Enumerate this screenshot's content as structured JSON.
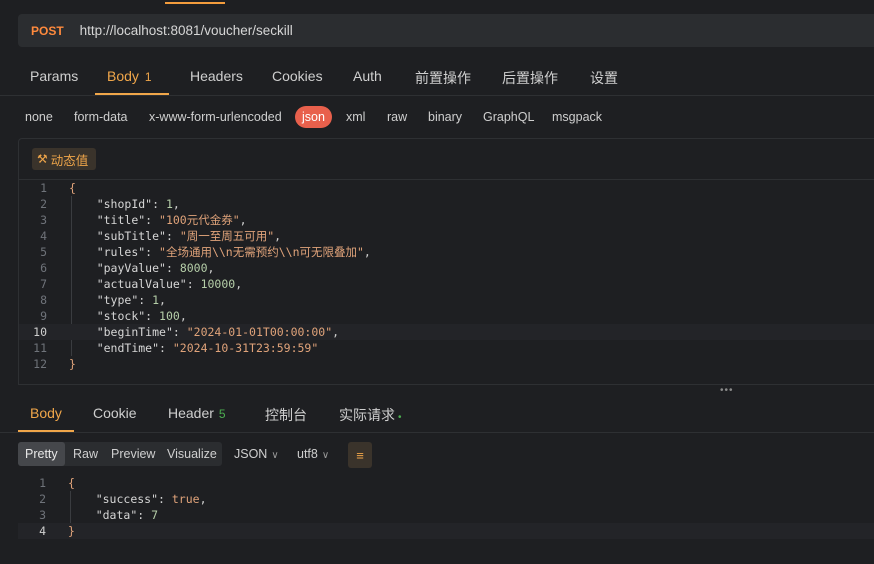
{
  "request": {
    "method": "POST",
    "url": "http://localhost:8081/voucher/seckill"
  },
  "request_tabs": [
    {
      "label": "Params"
    },
    {
      "label": "Body",
      "badge": "1"
    },
    {
      "label": "Headers"
    },
    {
      "label": "Cookies"
    },
    {
      "label": "Auth"
    },
    {
      "label": "前置操作"
    },
    {
      "label": "后置操作"
    },
    {
      "label": "设置"
    }
  ],
  "body_types": [
    "none",
    "form-data",
    "x-www-form-urlencoded",
    "json",
    "xml",
    "raw",
    "binary",
    "GraphQL",
    "msgpack"
  ],
  "selected_body_type": "json",
  "dynamic_value_label": "动态值",
  "request_body": {
    "line_numbers": [
      "1",
      "2",
      "3",
      "4",
      "5",
      "6",
      "7",
      "8",
      "9",
      "10",
      "11",
      "12"
    ],
    "current_line": "10",
    "fields": {
      "shopId_key": "\"shopId\"",
      "shopId_val": "1",
      "title_key": "\"title\"",
      "title_val": "\"100元代金券\"",
      "subTitle_key": "\"subTitle\"",
      "subTitle_val": "\"周一至周五可用\"",
      "rules_key": "\"rules\"",
      "rules_val": "\"全场通用\\\\n无需预约\\\\n可无限叠加\"",
      "payValue_key": "\"payValue\"",
      "payValue_val": "8000",
      "actualValue_key": "\"actualValue\"",
      "actualValue_val": "10000",
      "type_key": "\"type\"",
      "type_val": "1",
      "stock_key": "\"stock\"",
      "stock_val": "100",
      "beginTime_key": "\"beginTime\"",
      "beginTime_val": "\"2024-01-01T00:00:00\"",
      "endTime_key": "\"endTime\"",
      "endTime_val": "\"2024-10-31T23:59:59\""
    }
  },
  "response_tabs": [
    {
      "label": "Body"
    },
    {
      "label": "Cookie"
    },
    {
      "label": "Header",
      "badge": "5"
    },
    {
      "label": "控制台"
    },
    {
      "label": "实际请求",
      "dot": "•"
    }
  ],
  "view_modes": [
    "Pretty",
    "Raw",
    "Preview",
    "Visualize"
  ],
  "selected_view_mode": "Pretty",
  "format_select": "JSON",
  "encoding_select": "utf8",
  "response_body": {
    "line_numbers": [
      "1",
      "2",
      "3",
      "4"
    ],
    "current_line": "4",
    "success_key": "\"success\"",
    "success_val": "true",
    "data_key": "\"data\"",
    "data_val": "7"
  },
  "colors": {
    "accent": "#f0a64a",
    "method": "#ff8a3d",
    "selected_body_type_bg": "#e8604c",
    "badge_green": "#4caf50",
    "string": "#e0a37a",
    "number": "#b5cea8"
  },
  "icons": {
    "dynamic_value": "magic-wand-icon",
    "wrap": "wrap-lines-icon",
    "dropdown": "chevron-down-icon",
    "splitter": "drag-handle-icon"
  }
}
